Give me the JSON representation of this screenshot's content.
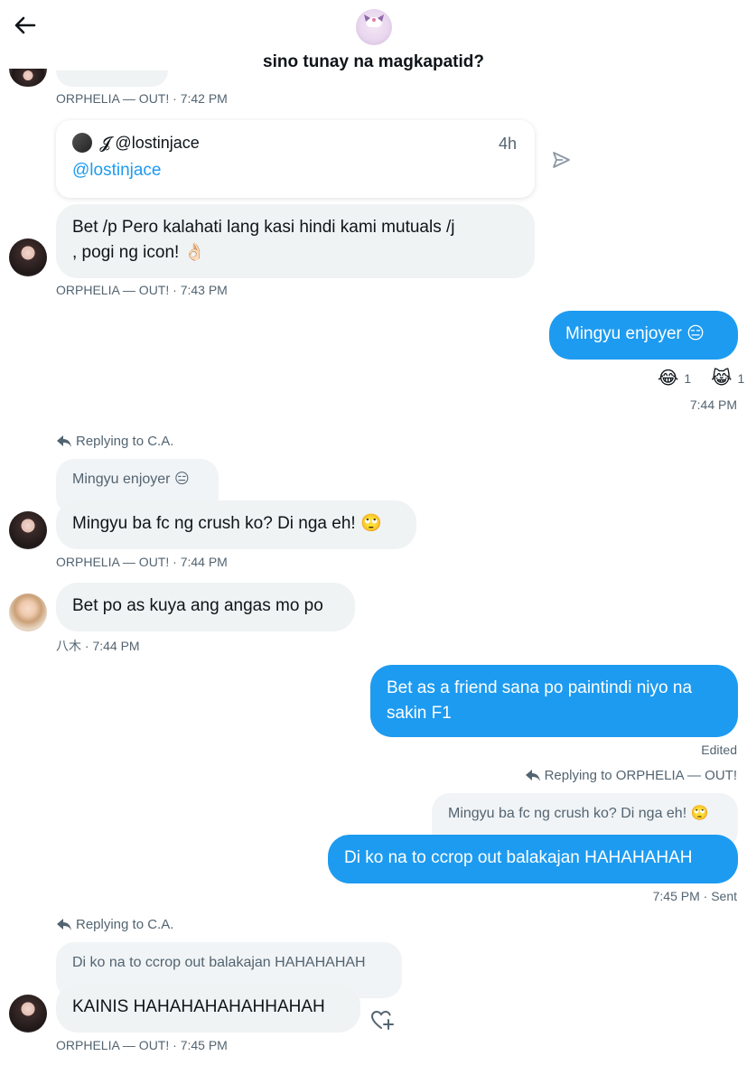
{
  "header": {
    "title": "sino tunay na magkapatid?"
  },
  "messages": {
    "m0_meta": "ORPHELIA — OUT! · 7:42 PM",
    "card": {
      "author": "𝓙 @lostinjace",
      "time": "4h",
      "handle": "@lostinjace"
    },
    "m1": {
      "line1": "Bet /p Pero kalahati lang kasi hindi kami mutuals /j",
      "line2": ", pogi ng icon! 👌🏻",
      "meta": "ORPHELIA — OUT! · 7:43 PM"
    },
    "m2": {
      "text": "Mingyu enjoyer 😑",
      "reaction1_emoji": "😂",
      "reaction1_count": "1",
      "reaction2_emoji": "😹",
      "reaction2_count": "1",
      "meta": "7:44 PM"
    },
    "m3": {
      "replying": "Replying to C.A.",
      "quote": "Mingyu enjoyer 😑",
      "text": "Mingyu ba fc ng crush ko? Di nga eh! 🙄",
      "meta": "ORPHELIA — OUT! · 7:44 PM"
    },
    "m4": {
      "text": "Bet po as kuya ang angas mo po",
      "meta": "八木 · 7:44 PM"
    },
    "m5": {
      "line1": "Bet as a friend sana po paintindi niyo na",
      "line2": "sakin F1",
      "meta": "Edited"
    },
    "m6": {
      "replying": "Replying to ORPHELIA — OUT!",
      "quote": "Mingyu ba fc ng crush ko? Di nga eh! 🙄",
      "text": "Di ko na to ccrop out balakajan HAHAHAHAH",
      "meta": "7:45 PM · Sent"
    },
    "m7": {
      "replying": "Replying to C.A.",
      "quote": "Di ko na to ccrop out balakajan HAHAHAHAH",
      "text": "KAINIS HAHAHAHAHAHHAHAH",
      "meta": "ORPHELIA — OUT! · 7:45 PM"
    }
  },
  "colors": {
    "accent": "#1d9bf0",
    "bubble_in": "#eff3f4",
    "meta_text": "#536471"
  },
  "icons": [
    "back-arrow-icon",
    "group-avatar",
    "share-icon",
    "reply-arrow-icon",
    "heart-plus-icon"
  ]
}
